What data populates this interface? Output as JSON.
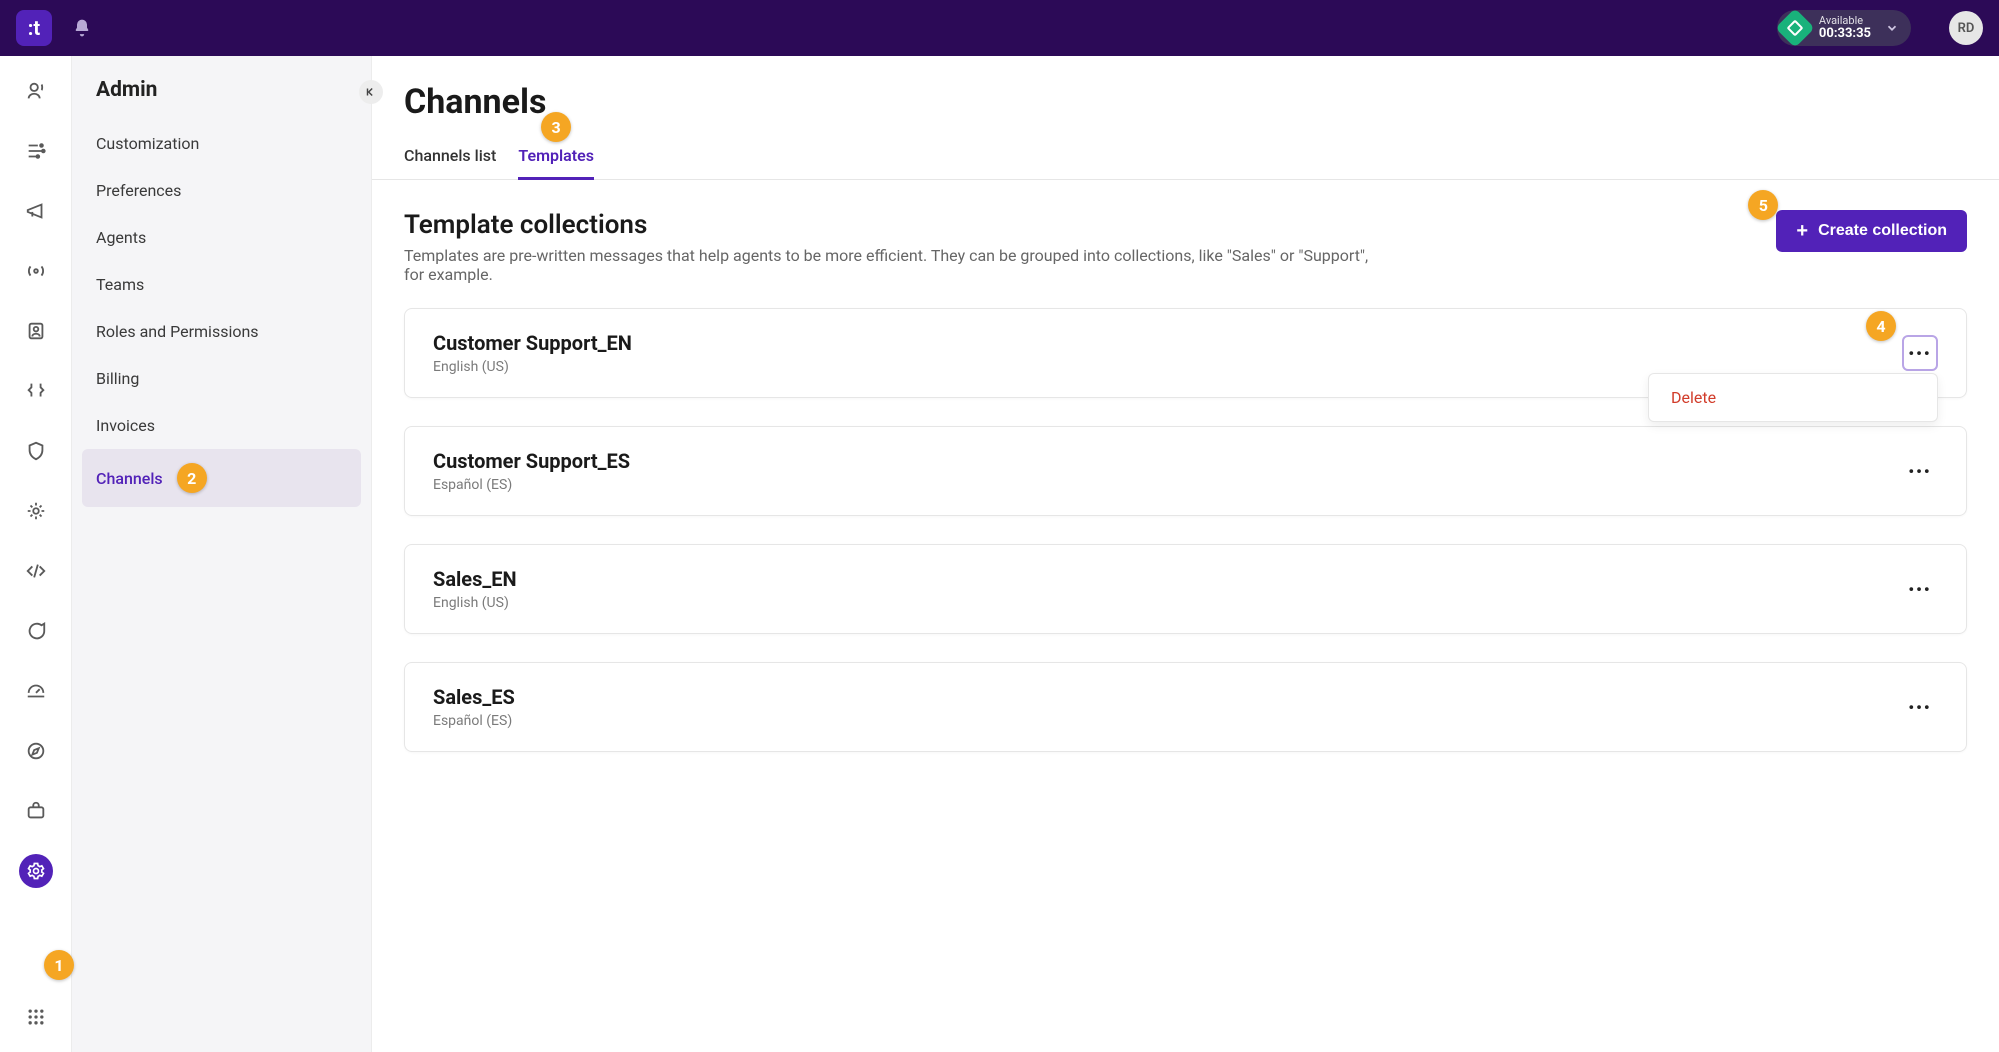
{
  "topbar": {
    "logo_glyph": ":t",
    "status_label": "Available",
    "status_time": "00:33:35",
    "avatar_initials": "RD"
  },
  "sidebar": {
    "title": "Admin",
    "items": [
      {
        "label": "Customization"
      },
      {
        "label": "Preferences"
      },
      {
        "label": "Agents"
      },
      {
        "label": "Teams"
      },
      {
        "label": "Roles and Permissions"
      },
      {
        "label": "Billing"
      },
      {
        "label": "Invoices"
      },
      {
        "label": "Channels"
      }
    ],
    "active_index": 7
  },
  "main": {
    "title": "Channels",
    "tabs": [
      {
        "label": "Channels list"
      },
      {
        "label": "Templates"
      }
    ],
    "active_tab": 1,
    "section_title": "Template collections",
    "section_desc": "Templates are pre-written messages that help agents to be more efficient. They can be grouped into collections, like \"Sales\" or \"Support\", for example.",
    "create_button": "Create collection",
    "collections": [
      {
        "name": "Customer Support_EN",
        "lang": "English (US)",
        "menu_open": true
      },
      {
        "name": "Customer Support_ES",
        "lang": "Español (ES)"
      },
      {
        "name": "Sales_EN",
        "lang": "English (US)"
      },
      {
        "name": "Sales_ES",
        "lang": "Español (ES)"
      }
    ],
    "dropdown": {
      "delete_label": "Delete"
    }
  },
  "annotations": [
    "1",
    "2",
    "3",
    "4",
    "5"
  ]
}
